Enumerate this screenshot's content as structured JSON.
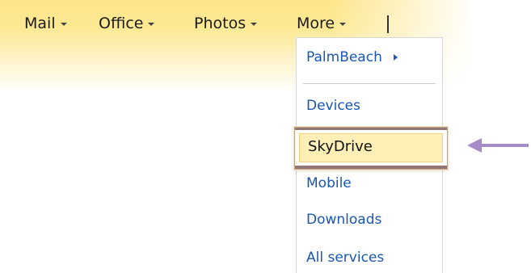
{
  "nav": {
    "items": [
      {
        "label": "Mail"
      },
      {
        "label": "Office"
      },
      {
        "label": "Photos"
      },
      {
        "label": "More"
      }
    ]
  },
  "more_menu": {
    "items": [
      {
        "label": "PalmBeach",
        "has_submenu": true
      },
      {
        "label": "Devices"
      },
      {
        "label": "SkyDrive",
        "highlighted": true
      },
      {
        "label": "Mobile"
      },
      {
        "label": "Downloads"
      },
      {
        "label": "All services"
      }
    ]
  },
  "colors": {
    "bar_yellow": "#fde58a",
    "menu_link": "#1a56b6",
    "highlight_fill": "#fdefb6",
    "highlight_frame": "#93767a",
    "annotation_arrow": "#a58bc8"
  },
  "annotation": {
    "icon": "left-arrow-icon"
  }
}
